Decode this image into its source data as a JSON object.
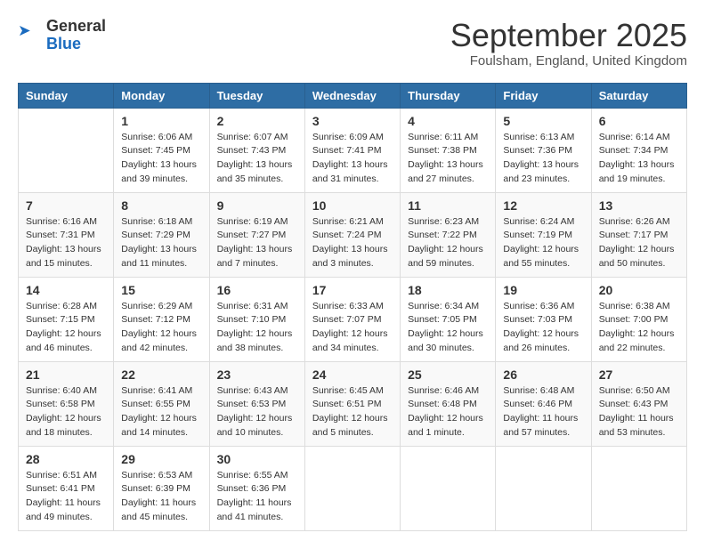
{
  "header": {
    "logo": {
      "general": "General",
      "blue": "Blue",
      "arrow_icon": "▶"
    },
    "title": "September 2025",
    "location": "Foulsham, England, United Kingdom"
  },
  "calendar": {
    "days_of_week": [
      "Sunday",
      "Monday",
      "Tuesday",
      "Wednesday",
      "Thursday",
      "Friday",
      "Saturday"
    ],
    "weeks": [
      [
        {
          "day": "",
          "sunrise": "",
          "sunset": "",
          "daylight": ""
        },
        {
          "day": "1",
          "sunrise": "Sunrise: 6:06 AM",
          "sunset": "Sunset: 7:45 PM",
          "daylight": "Daylight: 13 hours and 39 minutes."
        },
        {
          "day": "2",
          "sunrise": "Sunrise: 6:07 AM",
          "sunset": "Sunset: 7:43 PM",
          "daylight": "Daylight: 13 hours and 35 minutes."
        },
        {
          "day": "3",
          "sunrise": "Sunrise: 6:09 AM",
          "sunset": "Sunset: 7:41 PM",
          "daylight": "Daylight: 13 hours and 31 minutes."
        },
        {
          "day": "4",
          "sunrise": "Sunrise: 6:11 AM",
          "sunset": "Sunset: 7:38 PM",
          "daylight": "Daylight: 13 hours and 27 minutes."
        },
        {
          "day": "5",
          "sunrise": "Sunrise: 6:13 AM",
          "sunset": "Sunset: 7:36 PM",
          "daylight": "Daylight: 13 hours and 23 minutes."
        },
        {
          "day": "6",
          "sunrise": "Sunrise: 6:14 AM",
          "sunset": "Sunset: 7:34 PM",
          "daylight": "Daylight: 13 hours and 19 minutes."
        }
      ],
      [
        {
          "day": "7",
          "sunrise": "Sunrise: 6:16 AM",
          "sunset": "Sunset: 7:31 PM",
          "daylight": "Daylight: 13 hours and 15 minutes."
        },
        {
          "day": "8",
          "sunrise": "Sunrise: 6:18 AM",
          "sunset": "Sunset: 7:29 PM",
          "daylight": "Daylight: 13 hours and 11 minutes."
        },
        {
          "day": "9",
          "sunrise": "Sunrise: 6:19 AM",
          "sunset": "Sunset: 7:27 PM",
          "daylight": "Daylight: 13 hours and 7 minutes."
        },
        {
          "day": "10",
          "sunrise": "Sunrise: 6:21 AM",
          "sunset": "Sunset: 7:24 PM",
          "daylight": "Daylight: 13 hours and 3 minutes."
        },
        {
          "day": "11",
          "sunrise": "Sunrise: 6:23 AM",
          "sunset": "Sunset: 7:22 PM",
          "daylight": "Daylight: 12 hours and 59 minutes."
        },
        {
          "day": "12",
          "sunrise": "Sunrise: 6:24 AM",
          "sunset": "Sunset: 7:19 PM",
          "daylight": "Daylight: 12 hours and 55 minutes."
        },
        {
          "day": "13",
          "sunrise": "Sunrise: 6:26 AM",
          "sunset": "Sunset: 7:17 PM",
          "daylight": "Daylight: 12 hours and 50 minutes."
        }
      ],
      [
        {
          "day": "14",
          "sunrise": "Sunrise: 6:28 AM",
          "sunset": "Sunset: 7:15 PM",
          "daylight": "Daylight: 12 hours and 46 minutes."
        },
        {
          "day": "15",
          "sunrise": "Sunrise: 6:29 AM",
          "sunset": "Sunset: 7:12 PM",
          "daylight": "Daylight: 12 hours and 42 minutes."
        },
        {
          "day": "16",
          "sunrise": "Sunrise: 6:31 AM",
          "sunset": "Sunset: 7:10 PM",
          "daylight": "Daylight: 12 hours and 38 minutes."
        },
        {
          "day": "17",
          "sunrise": "Sunrise: 6:33 AM",
          "sunset": "Sunset: 7:07 PM",
          "daylight": "Daylight: 12 hours and 34 minutes."
        },
        {
          "day": "18",
          "sunrise": "Sunrise: 6:34 AM",
          "sunset": "Sunset: 7:05 PM",
          "daylight": "Daylight: 12 hours and 30 minutes."
        },
        {
          "day": "19",
          "sunrise": "Sunrise: 6:36 AM",
          "sunset": "Sunset: 7:03 PM",
          "daylight": "Daylight: 12 hours and 26 minutes."
        },
        {
          "day": "20",
          "sunrise": "Sunrise: 6:38 AM",
          "sunset": "Sunset: 7:00 PM",
          "daylight": "Daylight: 12 hours and 22 minutes."
        }
      ],
      [
        {
          "day": "21",
          "sunrise": "Sunrise: 6:40 AM",
          "sunset": "Sunset: 6:58 PM",
          "daylight": "Daylight: 12 hours and 18 minutes."
        },
        {
          "day": "22",
          "sunrise": "Sunrise: 6:41 AM",
          "sunset": "Sunset: 6:55 PM",
          "daylight": "Daylight: 12 hours and 14 minutes."
        },
        {
          "day": "23",
          "sunrise": "Sunrise: 6:43 AM",
          "sunset": "Sunset: 6:53 PM",
          "daylight": "Daylight: 12 hours and 10 minutes."
        },
        {
          "day": "24",
          "sunrise": "Sunrise: 6:45 AM",
          "sunset": "Sunset: 6:51 PM",
          "daylight": "Daylight: 12 hours and 5 minutes."
        },
        {
          "day": "25",
          "sunrise": "Sunrise: 6:46 AM",
          "sunset": "Sunset: 6:48 PM",
          "daylight": "Daylight: 12 hours and 1 minute."
        },
        {
          "day": "26",
          "sunrise": "Sunrise: 6:48 AM",
          "sunset": "Sunset: 6:46 PM",
          "daylight": "Daylight: 11 hours and 57 minutes."
        },
        {
          "day": "27",
          "sunrise": "Sunrise: 6:50 AM",
          "sunset": "Sunset: 6:43 PM",
          "daylight": "Daylight: 11 hours and 53 minutes."
        }
      ],
      [
        {
          "day": "28",
          "sunrise": "Sunrise: 6:51 AM",
          "sunset": "Sunset: 6:41 PM",
          "daylight": "Daylight: 11 hours and 49 minutes."
        },
        {
          "day": "29",
          "sunrise": "Sunrise: 6:53 AM",
          "sunset": "Sunset: 6:39 PM",
          "daylight": "Daylight: 11 hours and 45 minutes."
        },
        {
          "day": "30",
          "sunrise": "Sunrise: 6:55 AM",
          "sunset": "Sunset: 6:36 PM",
          "daylight": "Daylight: 11 hours and 41 minutes."
        },
        {
          "day": "",
          "sunrise": "",
          "sunset": "",
          "daylight": ""
        },
        {
          "day": "",
          "sunrise": "",
          "sunset": "",
          "daylight": ""
        },
        {
          "day": "",
          "sunrise": "",
          "sunset": "",
          "daylight": ""
        },
        {
          "day": "",
          "sunrise": "",
          "sunset": "",
          "daylight": ""
        }
      ]
    ]
  }
}
